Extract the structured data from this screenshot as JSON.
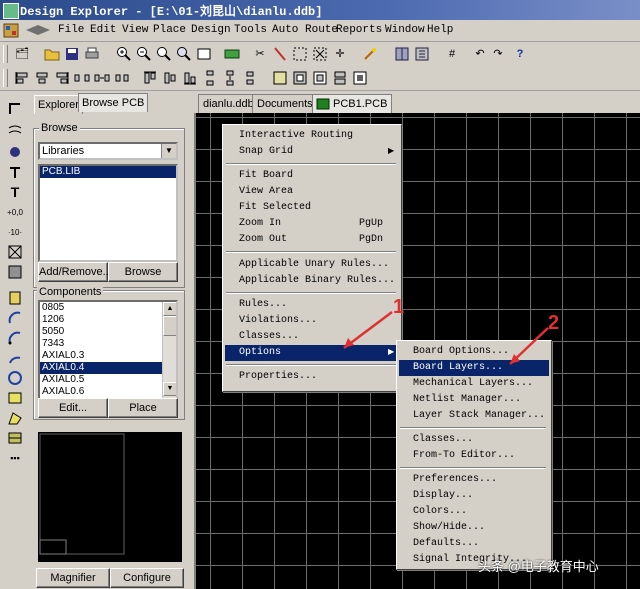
{
  "window": {
    "title": "Design Explorer - [E:\\01-刘昆山\\dianlu.ddb]"
  },
  "menubar": [
    "File",
    "Edit",
    "View",
    "Place",
    "Design",
    "Tools",
    "Auto Route",
    "Reports",
    "Window",
    "Help"
  ],
  "panel": {
    "tabs": [
      "Explorer",
      "Browse PCB"
    ],
    "browse_label": "Browse",
    "browse_select": "Libraries",
    "libraries": [
      "PCB.LIB"
    ],
    "add_remove": "Add/Remove...",
    "browse_button": "Browse",
    "components_label": "Components",
    "components": [
      "0805",
      "1206",
      "5050",
      "7343",
      "AXIAL0.3",
      "AXIAL0.4",
      "AXIAL0.5",
      "AXIAL0.6"
    ],
    "selected_component": "AXIAL0.4",
    "edit_button": "Edit...",
    "place_button": "Place",
    "magnifier_button": "Magnifier",
    "configure_button": "Configure"
  },
  "doc_tabs": [
    "dianlu.ddb",
    "Documents",
    "PCB1.PCB"
  ],
  "context_menu": {
    "items": [
      {
        "label": "Interactive Routing",
        "shortcut": "",
        "submenu": false
      },
      {
        "label": "Snap Grid",
        "shortcut": "",
        "submenu": true
      },
      {
        "label": "Fit Board",
        "shortcut": "",
        "submenu": false
      },
      {
        "label": "View Area",
        "shortcut": "",
        "submenu": false
      },
      {
        "label": "Fit Selected",
        "shortcut": "",
        "submenu": false
      },
      {
        "label": "Zoom In",
        "shortcut": "PgUp",
        "submenu": false
      },
      {
        "label": "Zoom Out",
        "shortcut": "PgDn",
        "submenu": false
      },
      {
        "label": "Applicable Unary Rules...",
        "shortcut": "",
        "submenu": false
      },
      {
        "label": "Applicable Binary Rules...",
        "shortcut": "",
        "submenu": false
      },
      {
        "label": "Rules...",
        "shortcut": "",
        "submenu": false
      },
      {
        "label": "Violations...",
        "shortcut": "",
        "submenu": false
      },
      {
        "label": "Classes...",
        "shortcut": "",
        "submenu": false
      },
      {
        "label": "Options",
        "shortcut": "",
        "submenu": true
      },
      {
        "label": "Properties...",
        "shortcut": "",
        "submenu": false
      }
    ],
    "highlighted": "Options"
  },
  "options_submenu": {
    "items": [
      "Board Options...",
      "Board Layers...",
      "Mechanical Layers...",
      "Netlist Manager...",
      "Layer Stack Manager...",
      "Classes...",
      "From-To Editor...",
      "Preferences...",
      "Display...",
      "Colors...",
      "Show/Hide...",
      "Defaults...",
      "Signal Integrity..."
    ],
    "highlighted": "Board Layers..."
  },
  "annotations": {
    "a1": "1",
    "a2": "2"
  },
  "watermark": "头条 @电子教育中心",
  "colors": {
    "highlight": "#0a246a",
    "annotation": "#e03030",
    "canvas": "#000000",
    "grid": "#6a6a6a"
  }
}
